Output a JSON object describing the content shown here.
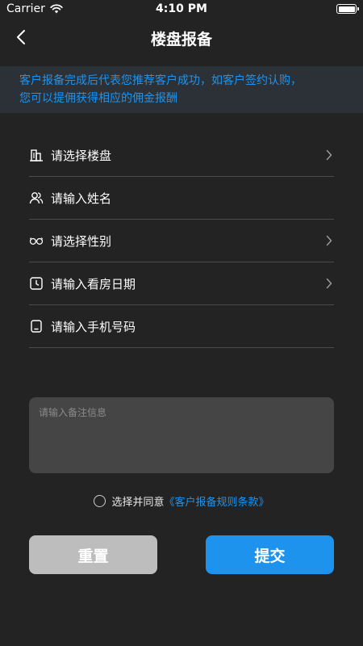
{
  "status_bar": {
    "carrier": "Carrier",
    "time": "4:10 PM"
  },
  "nav": {
    "title": "楼盘报备"
  },
  "notice": {
    "line1": "客户报备完成后代表您推荐客户成功，如客户签约认购，",
    "line2": "您可以提佣获得相应的佣金报酬"
  },
  "form": {
    "rows": [
      {
        "label": "请选择楼盘",
        "icon": "building-icon",
        "has_chevron": true
      },
      {
        "label": "请输入姓名",
        "icon": "people-icon",
        "has_chevron": false
      },
      {
        "label": "请选择性别",
        "icon": "gender-icon",
        "has_chevron": true
      },
      {
        "label": "请输入看房日期",
        "icon": "clock-icon",
        "has_chevron": true
      },
      {
        "label": "请输入手机号码",
        "icon": "phone-icon",
        "has_chevron": false
      }
    ]
  },
  "remark": {
    "placeholder": "请输入备注信息"
  },
  "agreement": {
    "text": "选择并同意",
    "link": "《客户报备规则条款》"
  },
  "buttons": {
    "reset": "重置",
    "submit": "提交"
  },
  "colors": {
    "background": "#232323",
    "accent": "#1d93ee",
    "notice_bg": "#2c3138",
    "reset_bg": "#bdbdbd"
  }
}
